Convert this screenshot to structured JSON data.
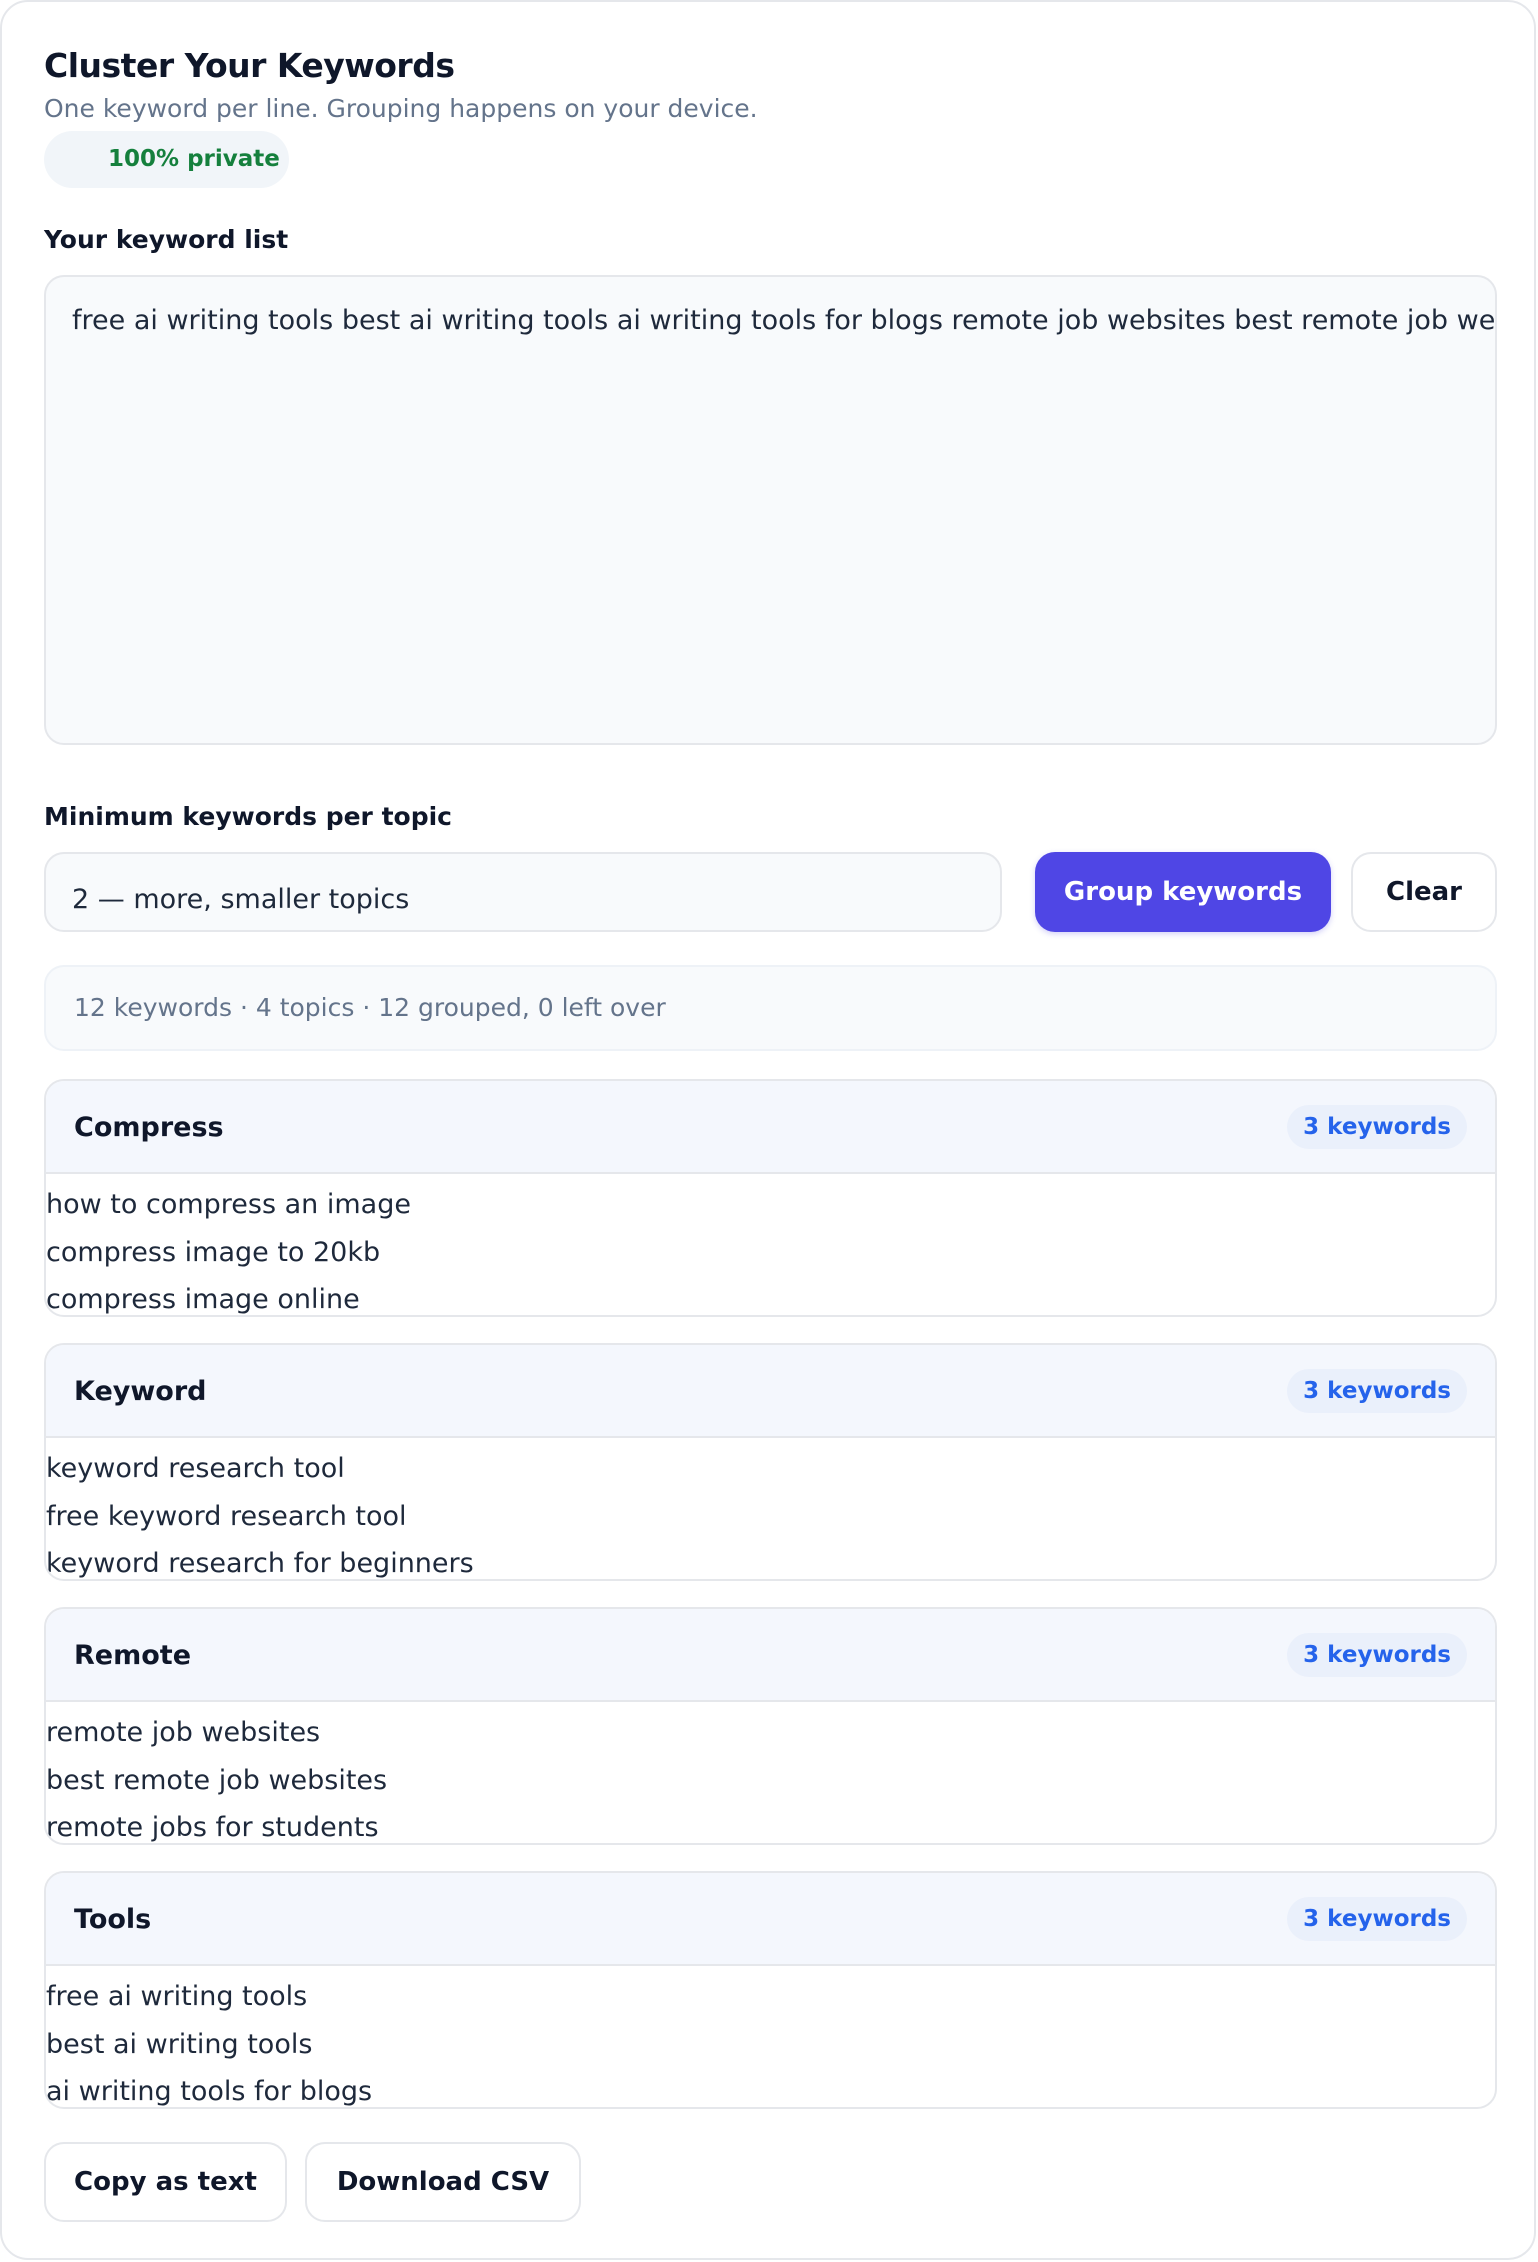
{
  "header": {
    "title": "Cluster Your Keywords",
    "subtitle": "One keyword per line. Grouping happens on your device.",
    "privacy_badge": "100% private"
  },
  "input": {
    "label": "Your keyword list",
    "value": "free ai writing tools best ai writing tools ai writing tools for blogs remote job websites best remote job we"
  },
  "settings": {
    "label": "Minimum keywords per topic",
    "selected_value": "2 — more, smaller topics"
  },
  "actions": {
    "group_label": "Group keywords",
    "clear_label": "Clear"
  },
  "summary": {
    "text": "12 keywords · 4 topics · 12 grouped, 0 left over"
  },
  "clusters": [
    {
      "name": "Compress",
      "count_label": "3 keywords",
      "keywords": [
        "how to compress an image",
        "compress image to 20kb",
        "compress image online"
      ]
    },
    {
      "name": "Keyword",
      "count_label": "3 keywords",
      "keywords": [
        "keyword research tool",
        "free keyword research tool",
        "keyword research for beginners"
      ]
    },
    {
      "name": "Remote",
      "count_label": "3 keywords",
      "keywords": [
        "remote job websites",
        "best remote job websites",
        "remote jobs for students"
      ]
    },
    {
      "name": "Tools",
      "count_label": "3 keywords",
      "keywords": [
        "free ai writing tools",
        "best ai writing tools",
        "ai writing tools for blogs"
      ]
    }
  ],
  "export": {
    "copy_label": "Copy as text",
    "download_label": "Download CSV"
  },
  "colors": {
    "accent": "#4f46e5",
    "badge_text": "#2563eb",
    "private_text": "#15803d",
    "muted_text": "#64748b"
  }
}
